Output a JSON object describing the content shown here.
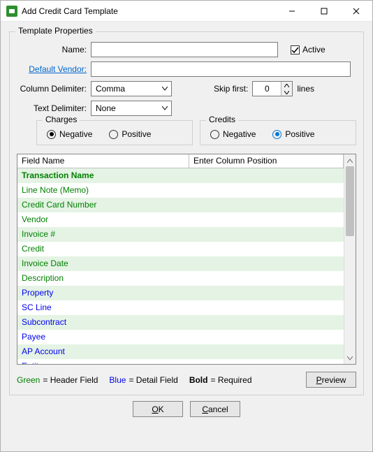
{
  "window": {
    "title": "Add Credit Card Template"
  },
  "group": {
    "title": "Template Properties"
  },
  "labels": {
    "name": "Name:",
    "active": "Active",
    "vendor": "Default Vendor:",
    "colDelim": "Column Delimiter:",
    "txtDelim": "Text Delimiter:",
    "skipFirst": "Skip first:",
    "lines": "lines",
    "charges": "Charges",
    "credits": "Credits",
    "negative": "Negative",
    "positive": "Positive"
  },
  "values": {
    "colDelim": "Comma",
    "txtDelim": "None",
    "skip": "0"
  },
  "grid": {
    "headers": {
      "field": "Field Name",
      "pos": "Enter Column Position"
    },
    "rows": [
      {
        "name": "Transaction Name",
        "color": "green",
        "bold": true
      },
      {
        "name": "Line Note (Memo)",
        "color": "green"
      },
      {
        "name": "Credit Card Number",
        "color": "green"
      },
      {
        "name": "Vendor",
        "color": "green"
      },
      {
        "name": "Invoice #",
        "color": "green"
      },
      {
        "name": "Credit",
        "color": "green"
      },
      {
        "name": "Invoice Date",
        "color": "green"
      },
      {
        "name": "Description",
        "color": "green"
      },
      {
        "name": "Property",
        "color": "blue"
      },
      {
        "name": "SC Line",
        "color": "blue"
      },
      {
        "name": "Subcontract",
        "color": "blue"
      },
      {
        "name": "Payee",
        "color": "blue"
      },
      {
        "name": "AP Account",
        "color": "blue"
      },
      {
        "name": "Entity",
        "color": "blue"
      }
    ]
  },
  "legend": {
    "green": "Green",
    "greenEq": " = Header Field",
    "blue": "Blue",
    "blueEq": " = Detail Field",
    "bold": "Bold",
    "boldEq": " = Required"
  },
  "buttons": {
    "preview": "review",
    "previewU": "P",
    "ok": "K",
    "okU": "O",
    "cancel": "ancel",
    "cancelU": "C"
  }
}
